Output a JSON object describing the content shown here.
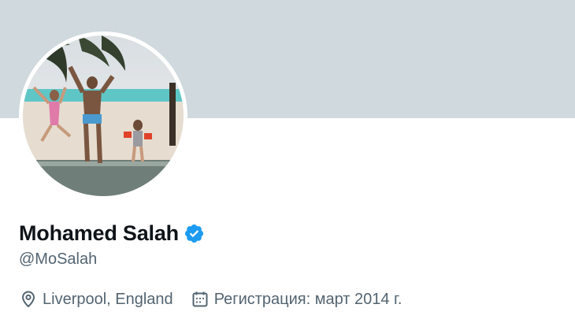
{
  "profile": {
    "display_name": "Mohamed Salah",
    "handle": "@MoSalah",
    "verified": true,
    "location": "Liverpool, England",
    "joined": "Регистрация: март 2014 г."
  },
  "icons": {
    "verified": "verified-badge-icon",
    "location": "location-pin-icon",
    "joined": "calendar-icon"
  },
  "colors": {
    "banner": "#cfd9de",
    "verified": "#1d9bf0",
    "name": "#0f1419",
    "secondary_text": "#536471"
  }
}
